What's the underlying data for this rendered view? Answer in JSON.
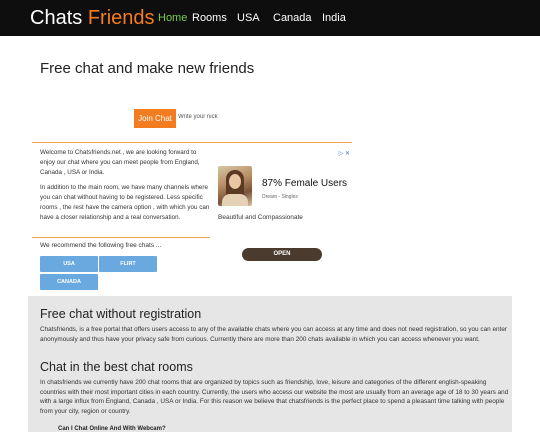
{
  "header": {
    "brand_part1": "Chats",
    "brand_part2": "Friends",
    "nav": [
      {
        "label": "Home",
        "active": true
      },
      {
        "label": "Rooms",
        "active": false
      },
      {
        "label": "USA",
        "active": false
      },
      {
        "label": "Canada",
        "active": false
      },
      {
        "label": "India",
        "active": false
      }
    ]
  },
  "main": {
    "headline": "Free chat and make new friends",
    "join_button": "Join Chat",
    "nick_placeholder": "Write your nick",
    "welcome_p1": "Welcome to Chatsfriends.net , we are looking forward to enjoy our chat where you can meet people from England, Canada , USA or India.",
    "welcome_p2": "In addition to the main room, we have many channels where you can chat without having to be registered. Less specific rooms , the rest have the camera option , with which you can have a closer relationship and a real conversation.",
    "recommend": "We recommend the following free chats ...",
    "chips": [
      "USA",
      "FLIRT",
      "CANADA"
    ]
  },
  "ad": {
    "choices": "▷ ✕",
    "title": "87% Female Users",
    "subtitle": "Dream - Singles",
    "description": "Beautiful and Compassionate",
    "cta": "OPEN"
  },
  "section": {
    "h1": "Free chat without registration",
    "p1": "Chatsfriends, is a free portal that offers users access to any of the available chats where you can access at any time and does not need registration, so you can enter anonymously and thus have your privacy safe from curious. Currently there are more than 200 chats available in which you can access whenever you want.",
    "h2": "Chat in the best chat rooms",
    "p2": "In chatsfriends we currently have 200 chat rooms that are organized by topics such as friendship, love, leisure and categories of the different english-speaking countries with their most important cities in each country. Currently, the users who access our website the most are usually from an average age of 18 to 30 years and with a large influx from England, Canada , USA or India. For this reason we believe that chatsfriends is the perfect place to spend a pleasant time talking with people from your city, region or country.",
    "faq1": "Can I Chat Online And With Webcam?"
  },
  "colors": {
    "brand_accent": "#f47c20",
    "nav_active": "#7bc94f",
    "header_bg": "#0e0e0e",
    "chip_bg": "#6aa9e0",
    "section_bg": "#e6e6e6"
  }
}
